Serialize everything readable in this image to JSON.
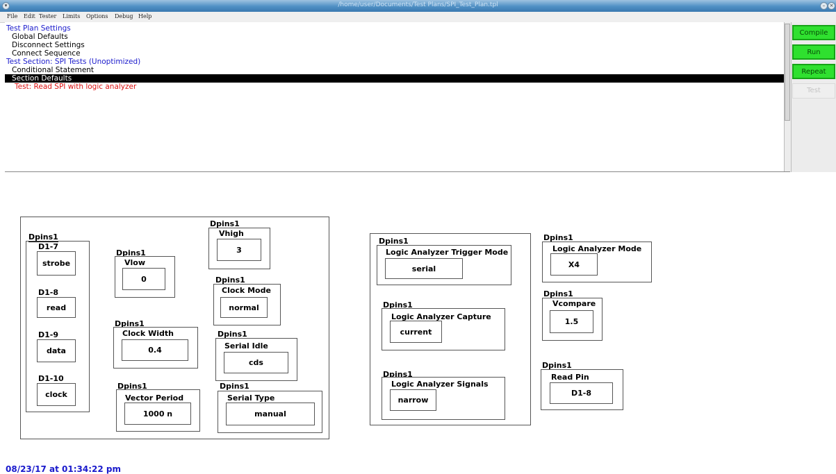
{
  "window": {
    "title": "/home/user/Documents/Test Plans/SPI_Test_Plan.tpl"
  },
  "menu": [
    "File",
    "Edit",
    "Tester",
    "Limits",
    "Options",
    "Debug",
    "Help"
  ],
  "tree": [
    {
      "label": "Test Plan Settings",
      "style": "blue"
    },
    {
      "label": "Global Defaults",
      "style": "normal"
    },
    {
      "label": "Disconnect Settings",
      "style": "normal"
    },
    {
      "label": "Connect Sequence",
      "style": "normal"
    },
    {
      "label": "Test Section: SPI Tests (Unoptimized)",
      "style": "blue"
    },
    {
      "label": "Conditional Statement",
      "style": "normal"
    },
    {
      "label": "Section Defaults",
      "style": "selected"
    },
    {
      "label": "Test: Read SPI with logic analyzer",
      "style": "red"
    }
  ],
  "buttons": {
    "compile": "Compile",
    "run": "Run",
    "repeat": "Repeat",
    "test": "Test"
  },
  "group1": {
    "pins": {
      "owner": "Dpins1",
      "items": [
        {
          "label": "D1-7",
          "value": "strobe"
        },
        {
          "label": "D1-8",
          "value": "read"
        },
        {
          "label": "D1-9",
          "value": "data"
        },
        {
          "label": "D1-10",
          "value": "clock"
        }
      ]
    },
    "vlow": {
      "owner": "Dpins1",
      "label": "Vlow",
      "value": "0"
    },
    "clock_width": {
      "owner": "Dpins1",
      "label": "Clock Width",
      "value": "0.4"
    },
    "vector_period": {
      "owner": "Dpins1",
      "label": "Vector Period",
      "value": "1000 n"
    },
    "vhigh": {
      "owner": "Dpins1",
      "label": "Vhigh",
      "value": "3"
    },
    "clock_mode": {
      "owner": "Dpins1",
      "label": "Clock Mode",
      "value": "normal"
    },
    "serial_idle": {
      "owner": "Dpins1",
      "label": "Serial Idle",
      "value": "cds"
    },
    "serial_type": {
      "owner": "Dpins1",
      "label": "Serial Type",
      "value": "manual"
    }
  },
  "group2": {
    "trigger_mode": {
      "owner": "Dpins1",
      "label": "Logic Analyzer Trigger Mode",
      "value": "serial"
    },
    "capture": {
      "owner": "Dpins1",
      "label": "Logic Analyzer Capture",
      "value": "current"
    },
    "signals": {
      "owner": "Dpins1",
      "label": "Logic Analyzer Signals",
      "value": "narrow"
    }
  },
  "group3": {
    "mode": {
      "owner": "Dpins1",
      "label": "Logic Analyzer Mode",
      "value": "X4"
    },
    "vcompare": {
      "owner": "Dpins1",
      "label": "Vcompare",
      "value": "1.5"
    },
    "read_pin": {
      "owner": "Dpins1",
      "label": "Read Pin",
      "value": "D1-8"
    }
  },
  "status": {
    "timestamp": "08/23/17 at 01:34:22 pm"
  }
}
